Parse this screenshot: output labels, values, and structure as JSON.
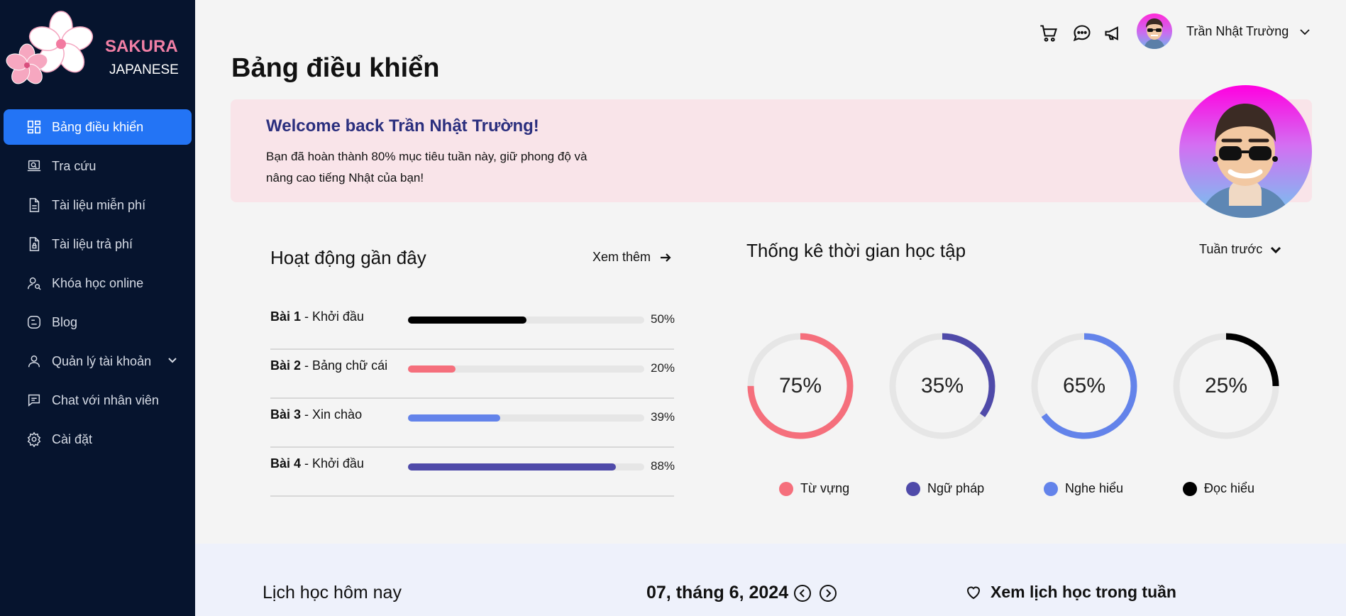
{
  "brand": {
    "name": "SAKURA",
    "sub": "JAPANESE"
  },
  "sidebar": {
    "items": [
      {
        "label": "Bảng điều khiển",
        "icon": "dashboard-icon",
        "active": true
      },
      {
        "label": "Tra cứu",
        "icon": "lookup-icon"
      },
      {
        "label": "Tài liệu miễn phí",
        "icon": "document-icon"
      },
      {
        "label": "Tài liệu trả phí",
        "icon": "paid-document-icon"
      },
      {
        "label": "Khóa học online",
        "icon": "course-icon"
      },
      {
        "label": "Blog",
        "icon": "blog-icon"
      },
      {
        "label": "Quản lý tài khoản",
        "icon": "user-icon"
      },
      {
        "label": "Chat với nhân viên",
        "icon": "chat-icon"
      },
      {
        "label": "Cài đặt",
        "icon": "settings-icon"
      }
    ]
  },
  "header": {
    "user_name": "Trần Nhật Trường"
  },
  "page": {
    "title": "Bảng điều khiển"
  },
  "welcome": {
    "title": "Welcome back Trần Nhật Trường!",
    "text": "Bạn đã hoàn thành 80% mục tiêu tuần này, giữ phong độ và nâng cao tiếng Nhật của bạn!"
  },
  "activity": {
    "title": "Hoạt động gần đây",
    "see_more": "Xem thêm",
    "lessons": [
      {
        "num": "Bài 1",
        "name": " - Khởi đầu",
        "percent": 50,
        "percent_label": "50%",
        "color": "#000000"
      },
      {
        "num": "Bài 2",
        "name": " - Bảng chữ cái",
        "percent": 20,
        "percent_label": "20%",
        "color": "#f56f7c"
      },
      {
        "num": "Bài 3",
        "name": " - Xin chào",
        "percent": 39,
        "percent_label": "39%",
        "color": "#6383ea"
      },
      {
        "num": "Bài 4",
        "name": " - Khởi đầu",
        "percent": 88,
        "percent_label": "88%",
        "color": "#4f4aa9"
      }
    ]
  },
  "stats": {
    "title": "Thống kê thời gian học tập",
    "period": "Tuần trước",
    "items": [
      {
        "label": "Từ vựng",
        "percent": 75,
        "percent_label": "75%",
        "color": "#f56f7c"
      },
      {
        "label": "Ngữ pháp",
        "percent": 35,
        "percent_label": "35%",
        "color": "#4f4aa9"
      },
      {
        "label": "Nghe hiểu",
        "percent": 65,
        "percent_label": "65%",
        "color": "#6383ea"
      },
      {
        "label": "Đọc hiểu",
        "percent": 25,
        "percent_label": "25%",
        "color": "#000000"
      }
    ]
  },
  "schedule": {
    "title": "Lịch học hôm nay",
    "date": "07, tháng 6, 2024",
    "week_link": "Xem lịch học trong tuần"
  }
}
